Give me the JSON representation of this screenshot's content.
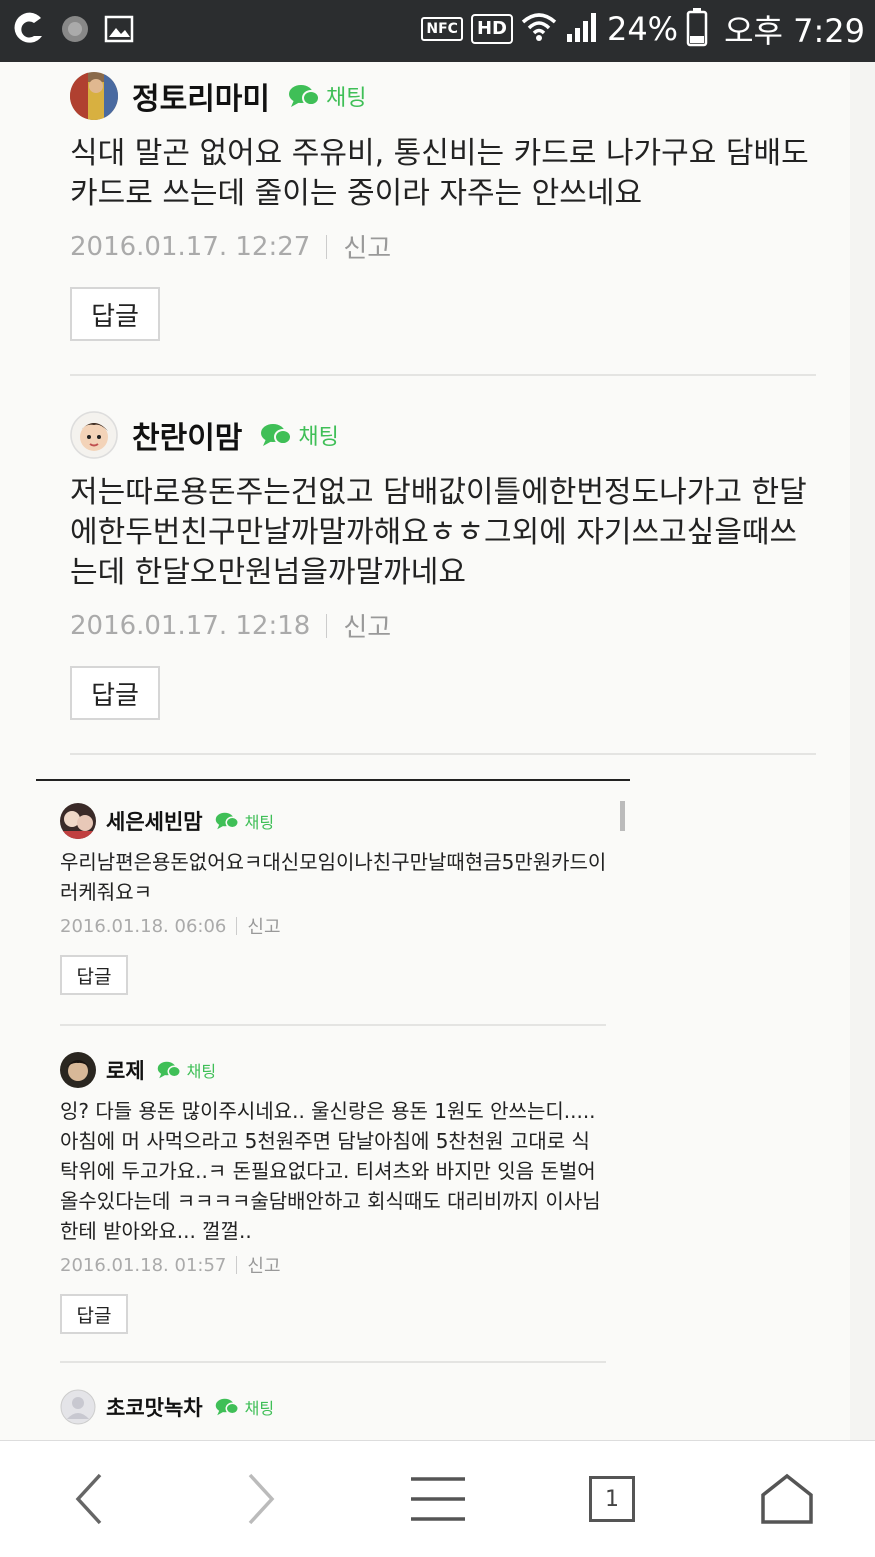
{
  "status_bar": {
    "nfc": "NFC",
    "hd": "HD",
    "battery": "24%",
    "time": "오후 7:29"
  },
  "colors": {
    "chat_green": "#3fbf57",
    "status_bg": "#2b2d2f"
  },
  "comments": [
    {
      "nickname": "정토리마미",
      "chat_label": "채팅",
      "body": "식대 말곤 없어요 주유비, 통신비는 카드로 나가구요 담배도 카드로 쓰는데 줄이는 중이라 자주는 안쓰네요",
      "date": "2016.01.17. 12:27",
      "report": "신고",
      "reply": "답글"
    },
    {
      "nickname": "찬란이맘",
      "chat_label": "채팅",
      "body": "저는따로용돈주는건없고 담배값이틀에한번정도나가고 한달에한두번친구만날까말까해요ㅎㅎ그외에 자기쓰고싶을때쓰는데 한달오만원넘을까말까네요",
      "date": "2016.01.17. 12:18",
      "report": "신고",
      "reply": "답글"
    }
  ],
  "inner_comments": [
    {
      "nickname": "세은세빈맘",
      "chat_label": "채팅",
      "body": "우리남편은용돈없어요ㅋ대신모임이나친구만날때현금5만원카드이러케줘요ㅋ",
      "date": "2016.01.18. 06:06",
      "report": "신고",
      "reply": "답글"
    },
    {
      "nickname": "로제",
      "chat_label": "채팅",
      "body": "잉? 다들 용돈 많이주시네요.. 울신랑은 용돈 1원도 안쓰는디..... 아침에 머 사먹으라고 5천원주면 담날아침에 5찬천원 고대로 식탁위에 두고가요..ㅋ 돈필요없다고. 티셔츠와 바지만 잇음 돈벌어올수있다는데 ㅋㅋㅋㅋ술담배안하고 회식때도 대리비까지 이사님한테 받아와요... 껄껄..",
      "date": "2016.01.18. 01:57",
      "report": "신고",
      "reply": "답글"
    },
    {
      "nickname": "초코맛녹차",
      "chat_label": "채팅"
    }
  ],
  "bottom_nav": {
    "tab_count": "1"
  }
}
